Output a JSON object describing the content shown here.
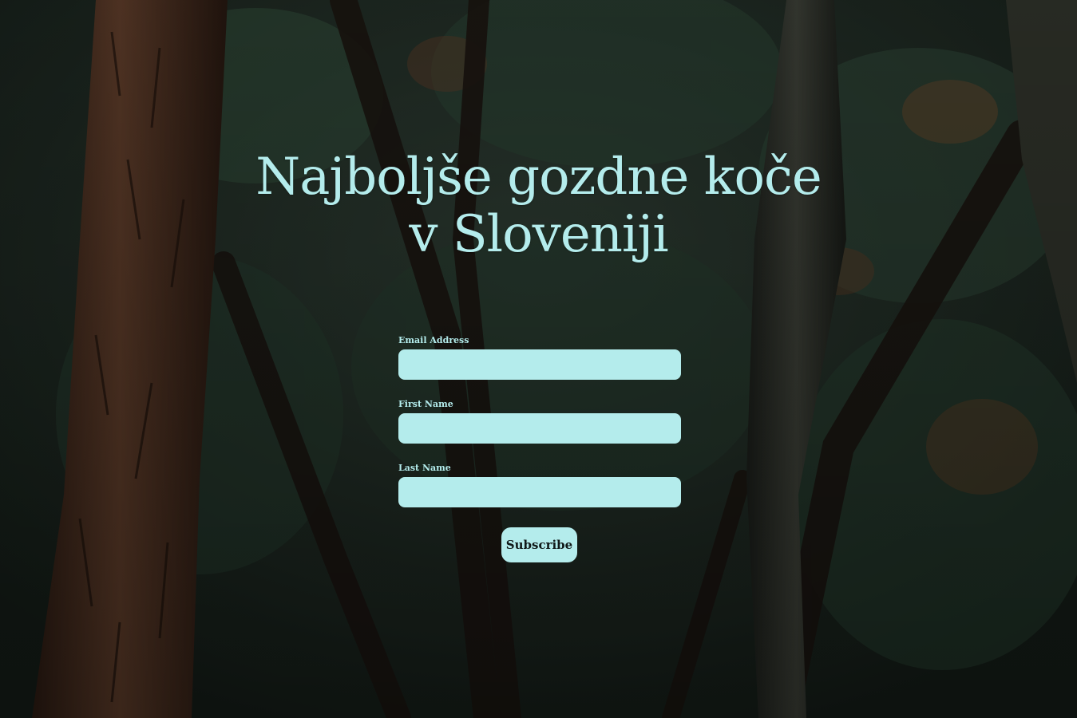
{
  "page": {
    "title_line1": "Najboljše gozdne koče",
    "title_line2": "v Sloveniji"
  },
  "form": {
    "fields": [
      {
        "label": "Email Address",
        "value": ""
      },
      {
        "label": "First Name",
        "value": ""
      },
      {
        "label": "Last Name",
        "value": ""
      }
    ],
    "submit_label": "Subscribe"
  },
  "colors": {
    "accent": "#b4ecec",
    "background": "#1c2620"
  }
}
